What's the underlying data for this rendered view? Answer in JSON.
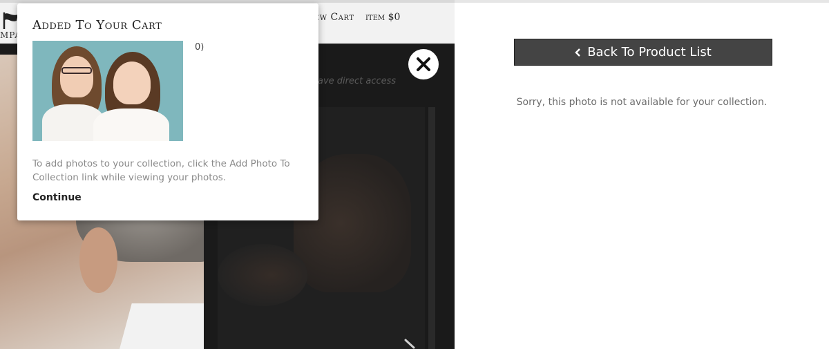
{
  "header": {
    "logo_text": "MPA",
    "view_cart_label": "ew Cart",
    "cart_summary": "item $0"
  },
  "photo_area": {
    "faded_text": "ave direct access"
  },
  "right_panel": {
    "back_button_label": "Back To Product List",
    "unavailable_message": "Sorry, this photo is not available for your collection."
  },
  "modal": {
    "title": "Added To Your Cart",
    "count_text": "0)",
    "instruction": "To add photos to your collection, click the Add Photo To Collection link while viewing your photos.",
    "continue_label": "Continue"
  },
  "icons": {
    "close": "close-icon",
    "back_chevron": "chevron-left-icon",
    "logo": "flag-logo-icon",
    "next": "chevron-right-icon"
  },
  "colors": {
    "button_bg": "#444444",
    "overlay_dark": "#1b1b1b",
    "modal_bg": "#ffffff"
  }
}
